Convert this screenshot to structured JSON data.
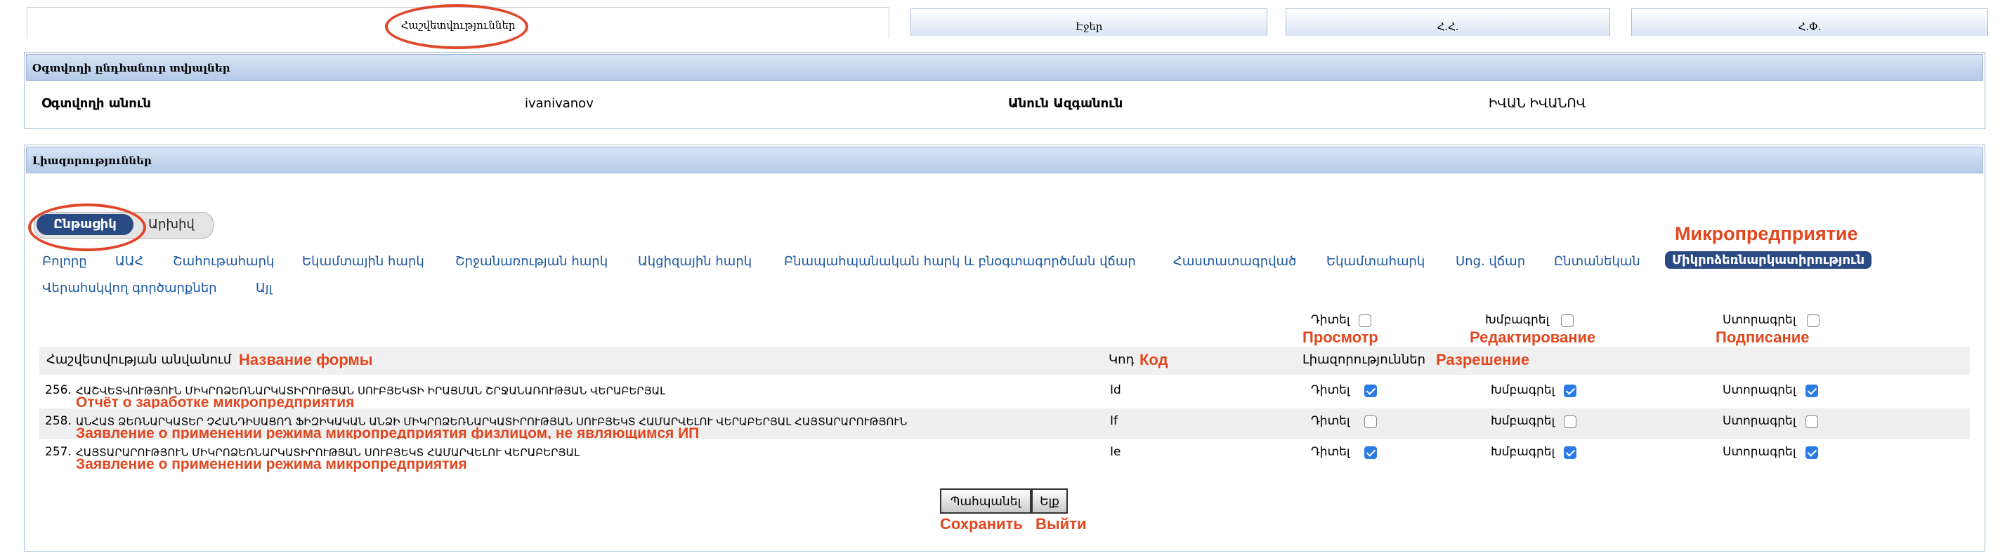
{
  "top_tabs": [
    "Հաշվետվություններ",
    "Էջեր",
    "Հ.Հ.",
    "Հ.Փ."
  ],
  "user_panel": {
    "title": "Օգտվողի ընդհանուր տվյալներ",
    "username_label": "Օգտվողի անուն",
    "username_value": "ivanivanov",
    "name_label": "Անուն Ազգանուն",
    "name_value": "ԻՎԱՆ ԻՎԱՆՈՎ"
  },
  "perm_panel": {
    "title": "Լիազորություններ",
    "toggle": {
      "active": "Ընթացիկ",
      "archive": "Արխիվ"
    },
    "categories_row1": [
      "Բոլորը",
      "ԱԱՀ",
      "Շահութահարկ",
      "Եկամտային հարկ",
      "Շրջանառության հարկ",
      "Ակցիզային հարկ",
      "Բնապահպանական հարկ և բնօգտագործման վճար",
      "Հաստատագրված",
      "Եկամտահարկ",
      "Սոց. վճար",
      "Ընտանեկան",
      "Միկրոձեռնարկատիրություն"
    ],
    "categories_row2": [
      "Վերահսկվող գործարքներ",
      "Այլ"
    ],
    "header_checks": [
      {
        "label": "Դիտել",
        "checked": false
      },
      {
        "label": "Խմբագրել",
        "checked": false
      },
      {
        "label": "Ստորագրել",
        "checked": false
      }
    ],
    "columns": {
      "name": "Հաշվետվության անվանում",
      "code": "Կոդ",
      "rights": "Լիազորություններ"
    },
    "rows": [
      {
        "num": "256.",
        "name": "ՀԱՇՎԵՏՎՈՒԹՅՈՒՆ ՄԻԿՐՈՁԵՌՆԱՐԿԱՏԻՐՈՒԹՅԱՆ ՍՈՒԲՅԵԿՏԻ ԻՐԱՑՄԱՆ ՇՐՋԱՆԱՌՈՒԹՅԱՆ ՎԵՐԱԲԵՐՅԱԼ",
        "code": "Id",
        "view": {
          "label": "Դիտել",
          "checked": true
        },
        "edit": {
          "label": "Խմբագրել",
          "checked": true
        },
        "sign": {
          "label": "Ստորագրել",
          "checked": true
        },
        "ru_note": "Отчёт о заработке микропредприятия"
      },
      {
        "num": "258.",
        "name": "ԱՆՀԱՏ ՁԵՌՆԱՐԿԱՏԵՐ ՉՀԱՆԴԻՍԱՑՈՂ ՖԻԶԻԿԱԿԱՆ ԱՆՁԻ ՄԻԿՐՈՁԵՌՆԱՐԿԱՏԻՐՈՒԹՅԱՆ ՍՈՒԲՅԵԿՏ ՀԱՄԱՐՎԵԼՈՒ ՎԵՐԱԲԵՐՅԱԼ ՀԱՅՏԱՐԱՐՈՒԹՅՈՒՆ",
        "code": "If",
        "view": {
          "label": "Դիտել",
          "checked": false
        },
        "edit": {
          "label": "Խմբագրել",
          "checked": false
        },
        "sign": {
          "label": "Ստորագրել",
          "checked": false
        },
        "ru_note": "Заявление о применении режима микропредприятия физлицом, не являющимся ИП"
      },
      {
        "num": "257.",
        "name": "ՀԱՅՏԱՐԱՐՈՒԹՅՈՒՆ ՄԻԿՐՈՁԵՌՆԱՐԿԱՏԻՐՈՒԹՅԱՆ ՍՈՒԲՅԵԿՏ ՀԱՄԱՐՎԵԼՈՒ ՎԵՐԱԲԵՐՅԱԼ",
        "code": "Ie",
        "view": {
          "label": "Դիտել",
          "checked": true
        },
        "edit": {
          "label": "Խմբագրել",
          "checked": true
        },
        "sign": {
          "label": "Ստորագրել",
          "checked": true
        },
        "ru_note": "Заявление о применении режима микропредприятия"
      }
    ],
    "buttons": {
      "save": "Պահպանել",
      "exit": "Ելք"
    }
  },
  "annotations": {
    "micro": "Микропредприятие",
    "view": "Просмотр",
    "edit": "Редактирование",
    "sign": "Подписание",
    "form_name": "Название формы",
    "code": "Код",
    "permission": "Разрешение",
    "save": "Сохранить",
    "exit": "Выйти"
  },
  "colors": {
    "accent": "#2a4a84",
    "link": "#1b57a0",
    "annotation": "#e0471f",
    "checkbox": "#2c7be5"
  }
}
